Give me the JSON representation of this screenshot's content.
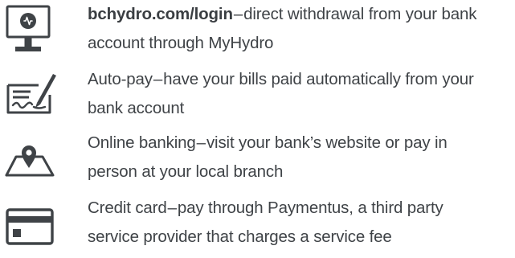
{
  "options": [
    {
      "icon": "computer-monitor-icon",
      "title": "bchydro.com/login",
      "title_bold": true,
      "separator": "–",
      "line1_rest": "direct withdrawal from your bank",
      "line2": "account through MyHydro"
    },
    {
      "icon": "signed-cheque-icon",
      "title": "Auto-pay",
      "title_bold": false,
      "separator": "–",
      "line1_rest": "have your bills paid automatically from your",
      "line2": "bank account"
    },
    {
      "icon": "map-location-pin-icon",
      "title": "Online banking",
      "title_bold": false,
      "separator": "–",
      "line1_rest": "visit your bank’s website or pay in",
      "line2": "person at your local branch"
    },
    {
      "icon": "credit-card-icon",
      "title": "Credit card",
      "title_bold": false,
      "separator": "–",
      "line1_rest": "pay through Paymentus, a third party",
      "line2": "service provider that charges a service fee"
    }
  ],
  "colors": {
    "text": "#3f4347",
    "icon": "#3f4347"
  }
}
